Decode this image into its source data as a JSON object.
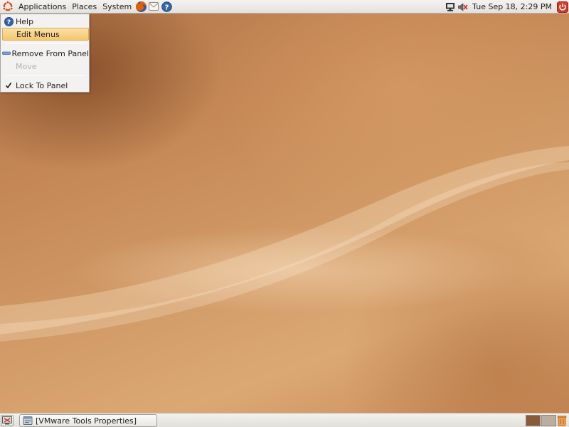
{
  "top_panel": {
    "menus": [
      {
        "label": "Applications"
      },
      {
        "label": "Places"
      },
      {
        "label": "System"
      }
    ],
    "launchers": [
      {
        "icon": "firefox-icon"
      },
      {
        "icon": "mail-icon"
      },
      {
        "icon": "help-icon"
      }
    ],
    "clock": "Tue Sep 18,  2:29 PM",
    "tray": [
      {
        "icon": "network-icon"
      },
      {
        "icon": "volume-icon"
      },
      {
        "icon": "power-icon"
      }
    ]
  },
  "panel_menu": {
    "items": [
      {
        "label": "Help",
        "icon": "help-icon",
        "state": "normal"
      },
      {
        "label": "Edit Menus",
        "icon": "",
        "state": "highlighted"
      },
      {
        "label": "Remove From Panel",
        "icon": "remove-icon",
        "state": "normal"
      },
      {
        "label": "Move",
        "icon": "",
        "state": "disabled"
      },
      {
        "label": "Lock To Panel",
        "icon": "checkmark-icon",
        "state": "checked"
      }
    ]
  },
  "bottom_panel": {
    "show_desktop_icon": "show-desktop-icon",
    "task_button": {
      "label": "[VMware Tools Properties]",
      "icon": "vmware-tools-icon"
    },
    "workspaces": [
      {
        "active": true,
        "color": "#8a5a3a"
      },
      {
        "active": false,
        "color": "#b9aea0"
      }
    ],
    "trash_icon": "trash-icon"
  },
  "colors": {
    "panel_bg": "#e9e7e3",
    "menu_highlight": "#f4c66e",
    "desktop_brown": "#c48755",
    "power_red": "#d43a2a",
    "ubuntu_orange": "#dd4814"
  }
}
